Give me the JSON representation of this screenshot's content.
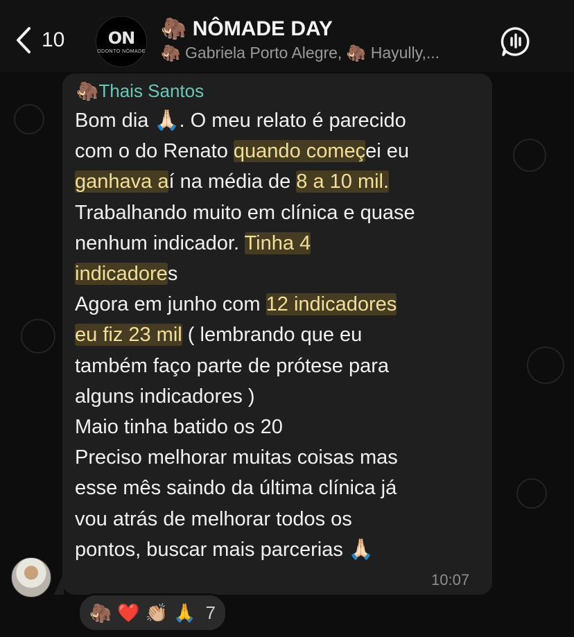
{
  "header": {
    "back_count": "10",
    "group_title": "🦣 NÔMADE DAY",
    "group_subtitle": "🦣 Gabriela Porto Alegre, 🦣 Hayully,...",
    "avatar_logo_mark": "ON",
    "avatar_logo_text": "ODONTO NÔMADE"
  },
  "message": {
    "sender": "🦣Thais Santos",
    "lines": {
      "l1": "Bom dia 🙏🏻. O meu relato é parecido",
      "l2a": "com o do Renato ",
      "l2b": "quando começ",
      "l2c": "ei eu",
      "l3a": "ganhava a",
      "l3b": "í na média de ",
      "l3c": "8 a 10 mil.",
      "l4": "Trabalhando muito em clínica e quase",
      "l5a": "nenhum indicador. ",
      "l5b": "Tinha 4",
      "l6a": "indicadore",
      "l6b": "s",
      "l7a": "Agora em junho com ",
      "l7b": "12 indicadores",
      "l8a": "eu fiz 23 mil",
      "l8b": " ( lembrando que eu",
      "l9": "também faço parte de prótese para",
      "l10": "alguns indicadores )",
      "l11": "Maio tinha batido os 20",
      "l12": "Preciso melhorar muitas coisas mas",
      "l13": "esse mês saindo da última clínica já",
      "l14": "vou atrás de melhorar todos os",
      "l15": "pontos, buscar mais parcerias 🙏🏻"
    },
    "time": "10:07"
  },
  "reactions": {
    "emojis": [
      "🦣",
      "❤️",
      "👏🏼",
      "🙏"
    ],
    "count": "7"
  },
  "colors": {
    "sender": "#69c9b9",
    "bubble": "#1f1f1f",
    "highlight": "#f1df9a",
    "header_bg": "#121212"
  },
  "icons": {
    "back": "chevron-left-icon",
    "voice": "voice-chat-icon"
  }
}
